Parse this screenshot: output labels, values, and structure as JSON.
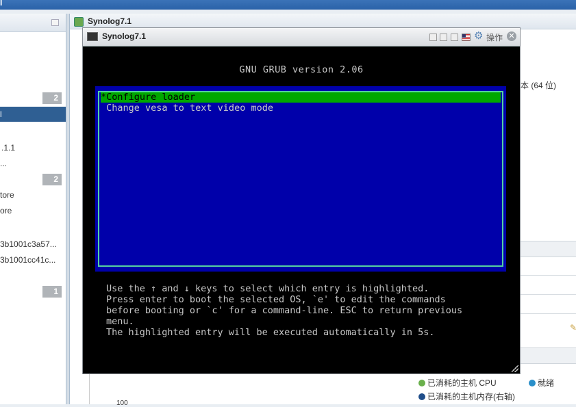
{
  "topbar": {
    "text": "I"
  },
  "navigator": {
    "badges": [
      "2",
      "2",
      "1"
    ],
    "items": [
      {
        "label": "l"
      },
      {
        "label": ".1.1"
      },
      {
        "label": "..."
      },
      {
        "label": "tore"
      },
      {
        "label": "ore"
      },
      {
        "label": "3b1001c3a57..."
      },
      {
        "label": "3b1001cc41c..."
      }
    ]
  },
  "main": {
    "title": "Synolog7.1",
    "cpu_info_fragment": "本 (64 位)",
    "legend": {
      "cpu": "已消耗的主机 CPU",
      "ready": "就绪",
      "memory": "已消耗的主机内存(右轴)"
    },
    "axis_fragment": "100"
  },
  "console": {
    "title": "Synolog7.1",
    "actions_label": "操作",
    "close_glyph": "✕",
    "gear_glyph": "⚙",
    "grub": {
      "title": "GNU GRUB  version 2.06",
      "entries": [
        {
          "label": "*Configure loader",
          "selected": true
        },
        {
          "label": " Change vesa to text video mode",
          "selected": false
        }
      ],
      "help_lines": [
        "Use the ↑ and ↓ keys to select which entry is highlighted.",
        "Press enter to boot the selected OS, `e' to edit the commands",
        "before booting or `c' for a command-line. ESC to return previous",
        "menu."
      ],
      "countdown": "The highlighted entry will be executed automatically in 5s."
    }
  },
  "colors": {
    "grub_menu_bg": "#0000aa",
    "grub_border": "#55d0a0",
    "grub_selected": "#00a800",
    "legend_cpu": "#6ab04c",
    "legend_ready": "#2a8fc9",
    "legend_memory": "#1f4e8a"
  }
}
